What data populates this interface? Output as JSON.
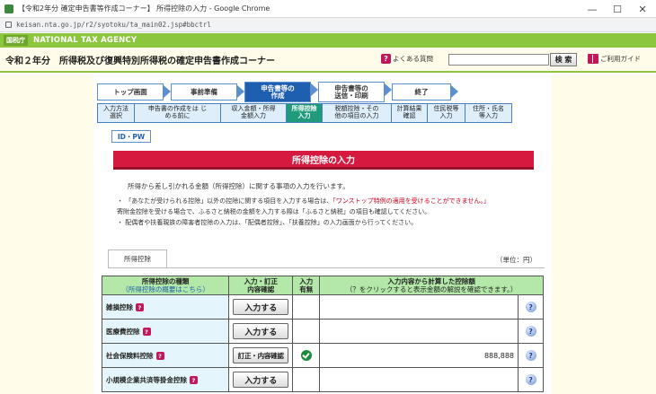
{
  "window": {
    "title": "【令和2年分 確定申告書等作成コーナー】 所得控除の入力 - Google Chrome",
    "url": "keisan.nta.go.jp/r2/syotoku/ta_main02.jsp#bbctrl",
    "minimize": "—",
    "maximize": "☐",
    "close": "✕"
  },
  "header": {
    "mark": "国税庁",
    "agency": "NATIONAL TAX AGENCY",
    "page_title": "令和２年分　所得税及び復興特別所得税の確定申告書作成コーナー",
    "faq_label": "よくある質問",
    "search_placeholder": "",
    "search_button": "検 索",
    "guide_label": "ご利用ガイド"
  },
  "steps": [
    {
      "label": "トップ画面"
    },
    {
      "label": "事前準備"
    },
    {
      "label": "申告書等の\n作成",
      "current": true
    },
    {
      "label": "申告書等の\n送信・印刷"
    },
    {
      "label": "終了"
    }
  ],
  "substeps": [
    {
      "label": "入力方法\n選択"
    },
    {
      "label": "申告書の作成をは じ\nめる前に"
    },
    {
      "label": "収入金額・所得\n金額入力"
    },
    {
      "label": "所得控除\n入力",
      "current": true
    },
    {
      "label": "税額控除・その\n他の項目の入力"
    },
    {
      "label": "計算結果\n確認"
    },
    {
      "label": "住民税等\n入力"
    },
    {
      "label": "住所・氏名\n等入力"
    }
  ],
  "idpw": "ID・PW",
  "banner": "所得控除の入力",
  "intro": "所得から差し引かれる金額（所得控除）に関する事項の入力を行います。",
  "notes": [
    {
      "text_a": "・ 「あなたが受けられる控除」以外の控除に関する項目を入力する場合は、",
      "text_red": "「ワンストップ特例の適用を受けることができません。」"
    },
    {
      "text_a": "  寄附金控除を受ける場合で、ふるさと納税の金額を入力する際は「ふるさと納税」の項目も確認してください。"
    },
    {
      "text_a": "・ 配偶者や扶養親族の障害者控除の入力は、「配偶者控除」、「扶養控除」の入力画面から行ってください。"
    }
  ],
  "tab_label": "所得控除",
  "unit_label": "（単位：円）",
  "table": {
    "headers": {
      "type": "所得控除の種類",
      "type_link": "（所得控除の概要はこちら）",
      "action": "入力・訂正\n内容確認",
      "has_input": "入力\n有無",
      "summary": "入力内容から計算した控除額",
      "summary_hint": "（？をクリックすると表示金額の解説を確認できます。）"
    },
    "rows": [
      {
        "type": "雑損控除",
        "button": "入力する",
        "has_input": false,
        "amount": ""
      },
      {
        "type": "医療費控除",
        "button": "入力する",
        "has_input": false,
        "amount": ""
      },
      {
        "type": "社会保険料控除",
        "button": "訂正・内容確認",
        "has_input": true,
        "amount": "888,888"
      },
      {
        "type": "小規模企業共済等掛金控除",
        "button": "入力する",
        "has_input": false,
        "amount": ""
      }
    ],
    "help_icon": "?"
  }
}
